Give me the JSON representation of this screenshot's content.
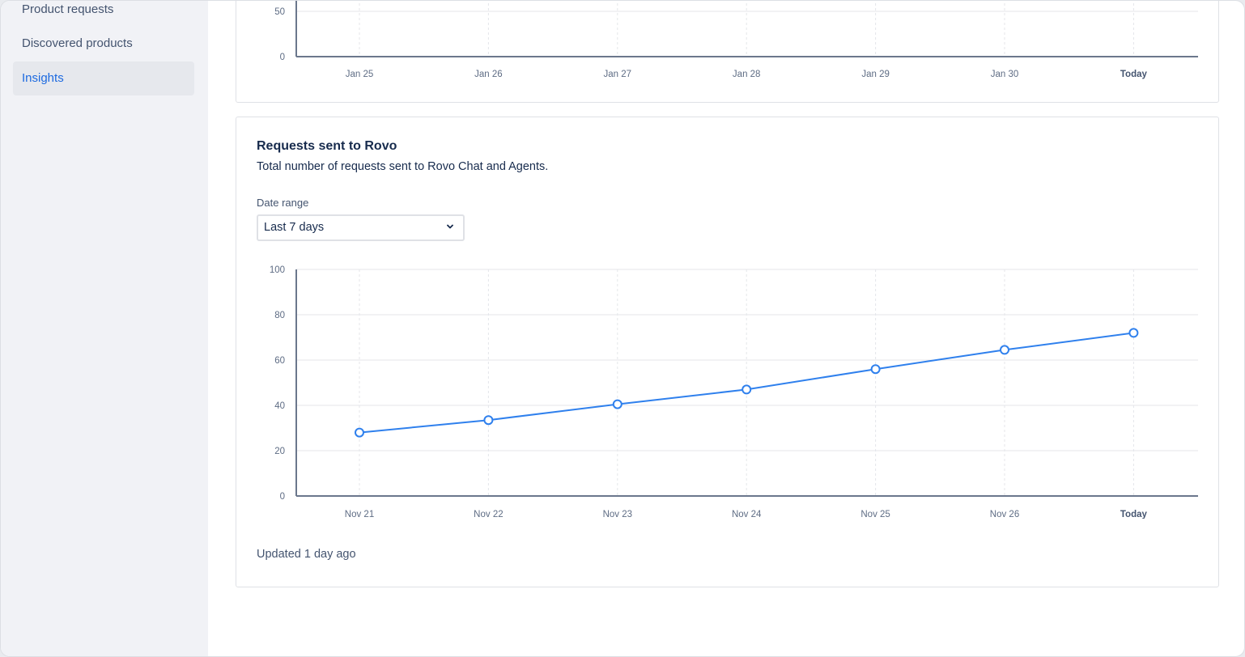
{
  "sidebar": {
    "items": [
      {
        "label": "Product requests",
        "active": false
      },
      {
        "label": "Discovered products",
        "active": false
      },
      {
        "label": "Insights",
        "active": true
      }
    ]
  },
  "top_chart": {
    "chart_data": {
      "type": "line",
      "categories": [
        "Jan 25",
        "Jan 26",
        "Jan 27",
        "Jan 28",
        "Jan 29",
        "Jan 30",
        "Today"
      ],
      "visible_y_ticks": [
        0,
        50
      ],
      "grid": true
    }
  },
  "requests_card": {
    "title": "Requests sent to Rovo",
    "description": "Total number of requests sent to Rovo Chat and Agents.",
    "date_range_label": "Date range",
    "date_range_value": "Last 7 days",
    "updated_text": "Updated 1 day ago"
  },
  "chart_data": {
    "type": "line",
    "categories": [
      "Nov 21",
      "Nov 22",
      "Nov 23",
      "Nov 24",
      "Nov 25",
      "Nov 26",
      "Today"
    ],
    "series": [
      {
        "values": [
          28,
          33.5,
          40.5,
          47,
          56,
          64.5,
          72
        ]
      }
    ],
    "ylim": [
      0,
      100
    ],
    "y_ticks": [
      0,
      20,
      40,
      60,
      80,
      100
    ],
    "grid": true,
    "colors": {
      "line": "#2f80ed",
      "grid": "#e4e6ea",
      "axis": "#6b778c"
    }
  }
}
